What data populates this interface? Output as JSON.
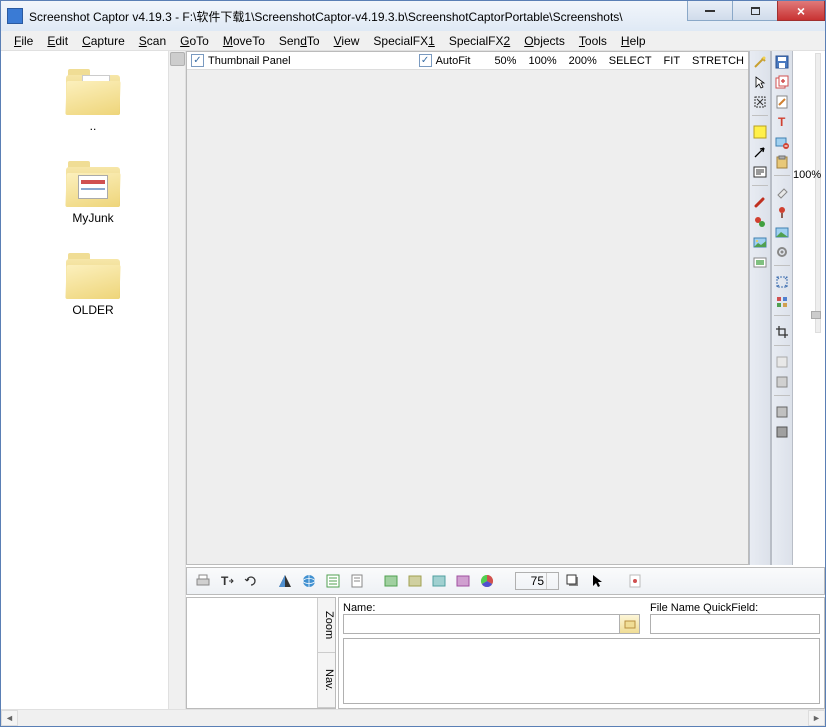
{
  "window": {
    "title": "Screenshot Captor v4.19.3 - F:\\软件下载1\\ScreenshotCaptor-v4.19.3.b\\ScreenshotCaptorPortable\\Screenshots\\"
  },
  "menu": {
    "file": "File",
    "edit": "Edit",
    "capture": "Capture",
    "scan": "Scan",
    "goto": "GoTo",
    "moveto": "MoveTo",
    "sendto": "SendTo",
    "view": "View",
    "fx1": "SpecialFX1",
    "fx2": "SpecialFX2",
    "objects": "Objects",
    "tools": "Tools",
    "help": "Help"
  },
  "folders": {
    "up": "..",
    "junk": "MyJunk",
    "older": "OLDER"
  },
  "canvasTop": {
    "thumbPanel": "Thumbnail Panel",
    "autoFit": "AutoFit",
    "z50": "50%",
    "z100": "100%",
    "z200": "200%",
    "select": "SELECT",
    "fit": "FIT",
    "stretch": "STRETCH"
  },
  "zoomStrip": {
    "label": "100%"
  },
  "bottom": {
    "num": "75"
  },
  "zoomNav": {
    "zoom": "Zoom",
    "nav": "Nav."
  },
  "namePanel": {
    "nameLabel": "Name:",
    "qfLabel": "File Name QuickField:"
  }
}
